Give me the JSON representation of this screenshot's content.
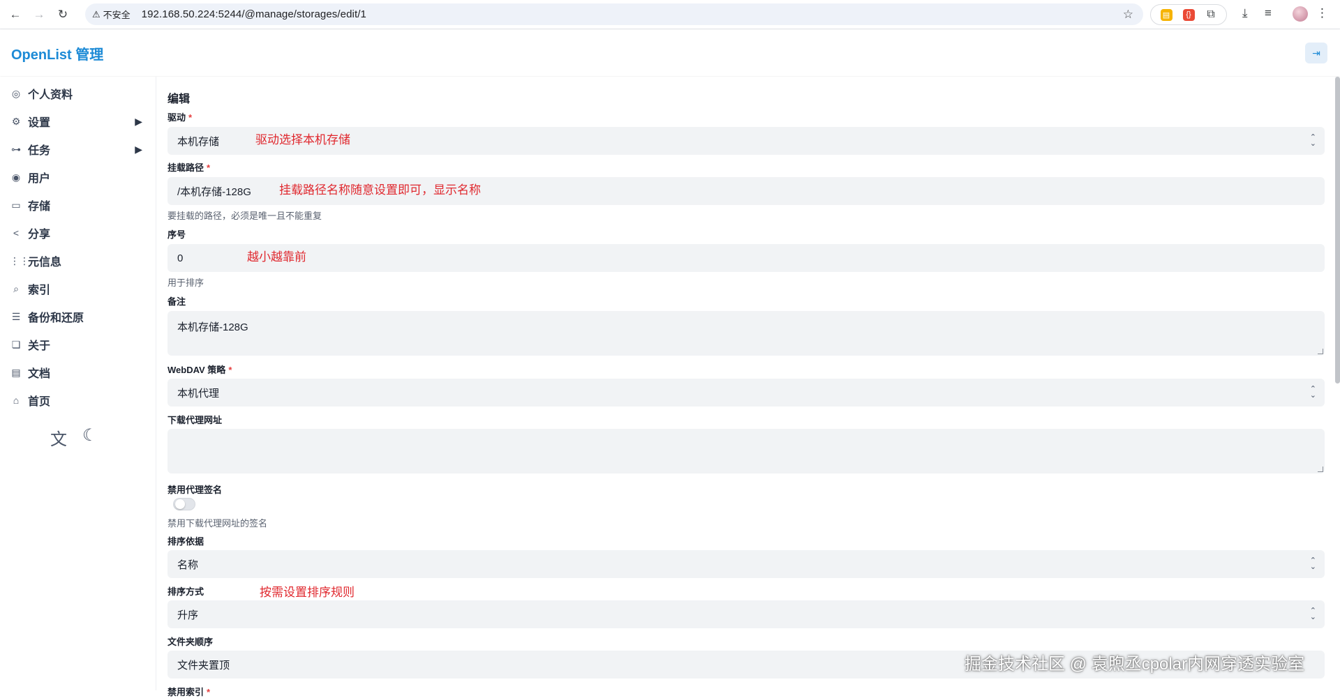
{
  "browser": {
    "security_label": "不安全",
    "url": "192.168.50.224:5244/@manage/storages/edit/1"
  },
  "header": {
    "brand": "OpenList 管理"
  },
  "sidebar": {
    "items": [
      {
        "label": "个人资料",
        "icon": "fingerprint-icon"
      },
      {
        "label": "设置",
        "icon": "gear-icon"
      },
      {
        "label": "任务",
        "icon": "workflow-icon"
      },
      {
        "label": "用户",
        "icon": "user-icon"
      },
      {
        "label": "存储",
        "icon": "storage-icon"
      },
      {
        "label": "分享",
        "icon": "share-icon"
      },
      {
        "label": "元信息",
        "icon": "meta-icon"
      },
      {
        "label": "索引",
        "icon": "search-icon"
      },
      {
        "label": "备份和还原",
        "icon": "database-icon"
      },
      {
        "label": "关于",
        "icon": "about-icon"
      },
      {
        "label": "文档",
        "icon": "book-icon"
      },
      {
        "label": "首页",
        "icon": "home-icon"
      }
    ]
  },
  "form": {
    "title": "编辑",
    "driver": {
      "label": "驱动",
      "required": "*",
      "value": "本机存储"
    },
    "mount_path": {
      "label": "挂载路径",
      "required": "*",
      "value": "/本机存储-128G",
      "help": "要挂载的路径，必须是唯一且不能重复"
    },
    "order": {
      "label": "序号",
      "value": "0",
      "help": "用于排序"
    },
    "remark": {
      "label": "备注",
      "value": "本机存储-128G"
    },
    "webdav_policy": {
      "label": "WebDAV 策略",
      "required": "*",
      "value": "本机代理"
    },
    "download_proxy_url": {
      "label": "下载代理网址",
      "value": ""
    },
    "disable_proxy_sign": {
      "label": "禁用代理签名",
      "help": "禁用下载代理网址的签名",
      "enabled": false
    },
    "order_by": {
      "label": "排序依据",
      "value": "名称"
    },
    "order_direction": {
      "label": "排序方式",
      "value": "升序"
    },
    "folder_order": {
      "label": "文件夹顺序",
      "value": "文件夹置顶"
    },
    "disable_index": {
      "label": "禁用索引",
      "required": "*"
    }
  },
  "annotations": {
    "driver": "驱动选择本机存储",
    "mount_path": "挂载路径名称随意设置即可，显示名称",
    "order": "越小越靠前",
    "order_direction": "按需设置排序规则"
  },
  "watermark": "掘金技术社区 @ 袁煦丞cpolar内网穿透实验室",
  "colors": {
    "brand": "#1c8ad6",
    "annotation": "#e0282e",
    "required": "#e53e3e",
    "field_bg": "#f1f3f5"
  }
}
